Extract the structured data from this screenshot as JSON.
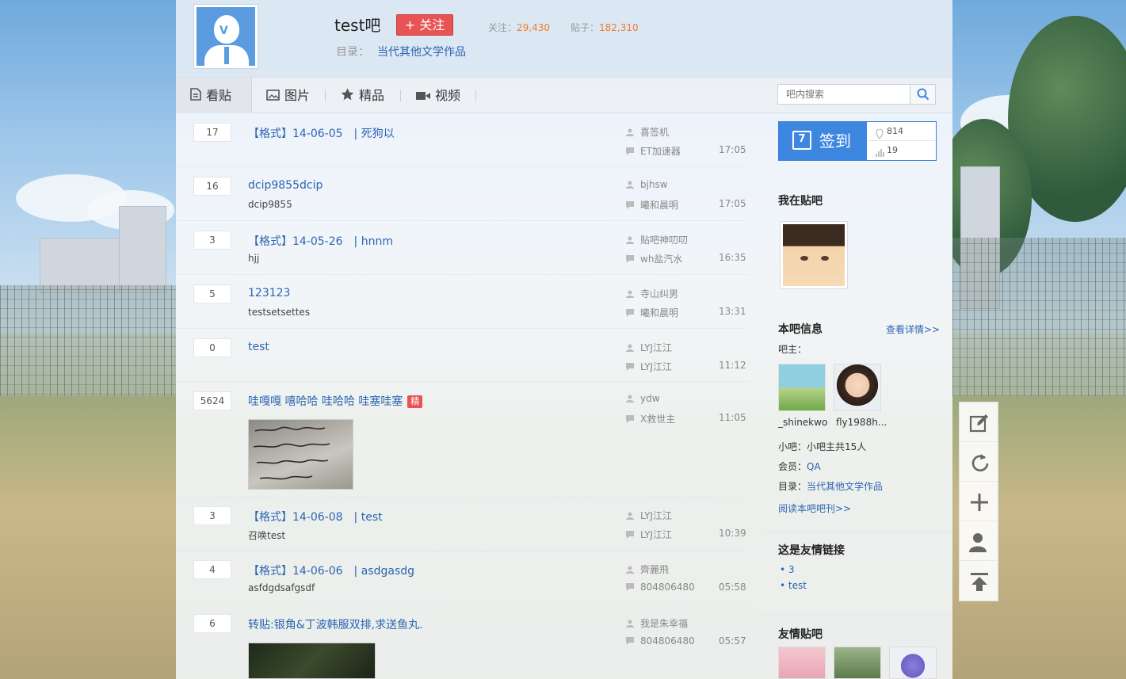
{
  "forum": {
    "title": "test吧",
    "follow_label": "+ 关注",
    "followers_label": "关注：",
    "followers": "29,430",
    "posts_label": "贴子：",
    "posts": "182,310",
    "catalog_label": "目录：",
    "catalog_value": "当代其他文学作品"
  },
  "nav": {
    "tabs": [
      "看贴",
      "图片",
      "精品",
      "视频"
    ],
    "search_placeholder": "吧内搜索"
  },
  "threads": [
    {
      "replies": "17",
      "title": "【格式】14-06-05　| 死狗以",
      "abstract": "",
      "author": "喜签机",
      "last_reply": "ET加速器",
      "time": "17:05"
    },
    {
      "replies": "16",
      "title": "dcip9855dcip",
      "abstract": "dcip9855",
      "author": "bjhsw",
      "last_reply": "曦和晨明",
      "time": "17:05"
    },
    {
      "replies": "3",
      "title": "【格式】14-05-26　| hnnm",
      "abstract": "hjj",
      "author": "贴吧神叨叨",
      "last_reply": "wh盐汽水",
      "time": "16:35"
    },
    {
      "replies": "5",
      "title": "123123",
      "abstract": "testsetsettes",
      "author": "寺山纠男",
      "last_reply": "曦和晨明",
      "time": "13:31"
    },
    {
      "replies": "0",
      "title": "test",
      "abstract": "",
      "author": "LYJ江江",
      "last_reply": "LYJ江江",
      "time": "11:12"
    },
    {
      "replies": "5624",
      "title": "哇嘎嘎 嘻哈哈 哇哈哈 哇塞哇塞",
      "badge": "精",
      "abstract": "",
      "author": "ydw",
      "last_reply": "X救世主",
      "time": "11:05"
    },
    {
      "replies": "3",
      "title": "【格式】14-06-08　| test",
      "abstract": "召唤test",
      "author": "LYJ江江",
      "last_reply": "LYJ江江",
      "time": "10:39"
    },
    {
      "replies": "4",
      "title": "【格式】14-06-06　| asdgasdg",
      "abstract": "asfdgdsafgsdf",
      "author": "齊麗飛",
      "last_reply": "804806480",
      "time": "05:58"
    },
    {
      "replies": "6",
      "title": "转贴:银角&丁波韩服双排,求送鱼丸.",
      "abstract": "",
      "author": "我是朱幸福",
      "last_reply": "804806480",
      "time": "05:57"
    }
  ],
  "sign": {
    "label": "签到",
    "calendar_day": "7",
    "rank": "814",
    "count": "19"
  },
  "sidebar": {
    "my_forum_title": "我在贴吧",
    "info_title": "本吧信息",
    "info_detail_link": "查看详情>>",
    "owner_label": "吧主：",
    "owners": [
      "_shinekwo",
      "fly1988h..."
    ],
    "small_owner_label": "小吧：",
    "small_owner_value": "小吧主共15人",
    "member_label": "会员：",
    "member_value": "QA",
    "catalog_label": "目录：",
    "catalog_value": "当代其他文学作品",
    "read_link": "阅读本吧吧刊>>",
    "links_title": "这是友情链接",
    "links": [
      "3",
      "test"
    ],
    "friend_forums_title": "友情贴吧"
  },
  "colors": {
    "accent_blue": "#3d87e0",
    "follow_red": "#e85353",
    "link_blue": "#2d64b3",
    "stat_orange": "#f27a2c"
  },
  "icons": {
    "tabs": [
      "document-icon",
      "image-icon",
      "star-icon",
      "video-icon"
    ],
    "float": [
      "edit-icon",
      "refresh-icon",
      "plus-icon",
      "user-icon",
      "back-to-top-icon"
    ]
  }
}
